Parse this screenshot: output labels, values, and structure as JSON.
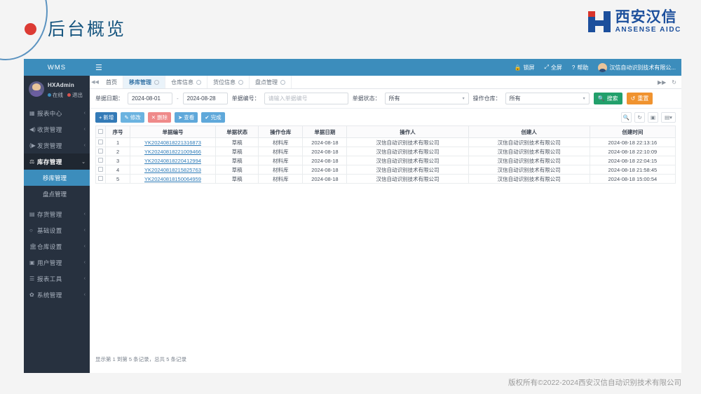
{
  "slide": {
    "title": "后台概览",
    "copyright": "版权所有©2022-2024西安汉信自动识别技术有限公司",
    "logo_cn": "西安汉信",
    "logo_en": "ANSENSE AIDC",
    "accent": "#3c8dbc",
    "brand_blue": "#1c4f9c",
    "brand_red": "#d9342b"
  },
  "sidebar": {
    "brand": "WMS",
    "user": {
      "name": "HXAdmin",
      "status": "在线",
      "logout": "退出"
    },
    "items": [
      {
        "label": "报表中心",
        "icon": "grid-icon",
        "arrow": "‹"
      },
      {
        "label": "收货管理",
        "icon": "inbound-icon",
        "arrow": "‹"
      },
      {
        "label": "发货管理",
        "icon": "outbound-icon",
        "arrow": "‹"
      },
      {
        "label": "库存管理",
        "icon": "stock-icon",
        "arrow": "⌄"
      }
    ],
    "sub_items": [
      {
        "label": "移库管理",
        "active": true
      },
      {
        "label": "盘点管理",
        "active": false
      }
    ],
    "items_lower": [
      {
        "label": "存货管理",
        "icon": "box-icon",
        "arrow": "‹"
      },
      {
        "label": "基础设置",
        "icon": "circle-icon",
        "arrow": "‹"
      },
      {
        "label": "仓库设置",
        "icon": "warehouse-icon",
        "arrow": "‹"
      },
      {
        "label": "用户管理",
        "icon": "user-icon",
        "arrow": "‹"
      },
      {
        "label": "报表工具",
        "icon": "report-icon",
        "arrow": "‹"
      },
      {
        "label": "系统管理",
        "icon": "gear-icon",
        "arrow": "‹"
      }
    ]
  },
  "topbar": {
    "menu_icon": "hamburger-icon",
    "lock": "锁屏",
    "fullscreen": "全屏",
    "help": "帮助",
    "company": "汉信自动识别技术有限公..."
  },
  "tabs": {
    "prev_icon": "◀◀",
    "items": [
      {
        "label": "首页",
        "closable": false,
        "active": false
      },
      {
        "label": "移库管理",
        "closable": true,
        "active": true
      },
      {
        "label": "仓库信息",
        "closable": true,
        "active": false
      },
      {
        "label": "货位信息",
        "closable": true,
        "active": false
      },
      {
        "label": "盘点管理",
        "closable": true,
        "active": false
      }
    ],
    "next_icon": "▶▶",
    "refresh_icon": "↻"
  },
  "filter": {
    "date_label": "单据日期：",
    "date_from": "2024-08-01",
    "date_sep": "-",
    "date_to": "2024-08-28",
    "code_label": "单据编号：",
    "code_placeholder": "请输入单据编号",
    "code_value": "",
    "status_label": "单据状态：",
    "status_value": "所有",
    "warehouse_label": "操作仓库：",
    "warehouse_value": "所有",
    "search_button": "搜索",
    "reset_button": "重置"
  },
  "toolbar": {
    "add": "新增",
    "edit": "修改",
    "delete": "删除",
    "view": "查看",
    "complete": "完成",
    "icons": [
      "search-icon",
      "refresh-icon",
      "columns-icon",
      "grid-toggle-icon"
    ]
  },
  "table": {
    "columns": [
      "序号",
      "单据编号",
      "单据状态",
      "操作仓库",
      "单据日期",
      "操作人",
      "创建人",
      "创建时间"
    ],
    "rows": [
      {
        "no": "1",
        "code": "YK20240818221316873",
        "status": "草稿",
        "warehouse": "材料库",
        "date": "2024-08-18",
        "operator": "汉信自动识别技术有限公司",
        "creator": "汉信自动识别技术有限公司",
        "created": "2024-08-18 22:13:16"
      },
      {
        "no": "2",
        "code": "YK20240818221009466",
        "status": "草稿",
        "warehouse": "材料库",
        "date": "2024-08-18",
        "operator": "汉信自动识别技术有限公司",
        "creator": "汉信自动识别技术有限公司",
        "created": "2024-08-18 22:10:09"
      },
      {
        "no": "3",
        "code": "YK20240818220412994",
        "status": "草稿",
        "warehouse": "材料库",
        "date": "2024-08-18",
        "operator": "汉信自动识别技术有限公司",
        "creator": "汉信自动识别技术有限公司",
        "created": "2024-08-18 22:04:15"
      },
      {
        "no": "4",
        "code": "YK20240818215825763",
        "status": "草稿",
        "warehouse": "材料库",
        "date": "2024-08-18",
        "operator": "汉信自动识别技术有限公司",
        "creator": "汉信自动识别技术有限公司",
        "created": "2024-08-18 21:58:45"
      },
      {
        "no": "5",
        "code": "YK20240818150064959",
        "status": "草稿",
        "warehouse": "材料库",
        "date": "2024-08-18",
        "operator": "汉信自动识别技术有限公司",
        "creator": "汉信自动识别技术有限公司",
        "created": "2024-08-18 15:00:54"
      }
    ],
    "pager": "显示第 1 到第 5 条记录，总共 5 条记录"
  }
}
